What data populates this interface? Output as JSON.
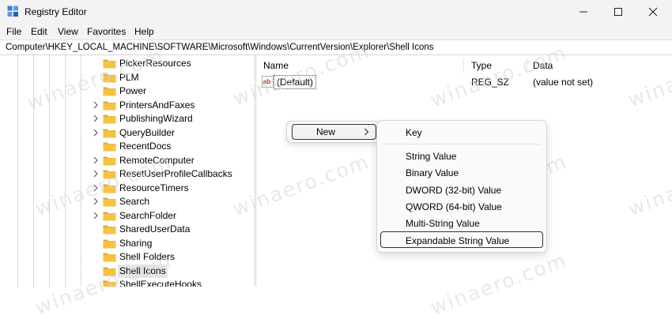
{
  "window": {
    "title": "Registry Editor"
  },
  "menu": [
    "File",
    "Edit",
    "View",
    "Favorites",
    "Help"
  ],
  "address": "Computer\\HKEY_LOCAL_MACHINE\\SOFTWARE\\Microsoft\\Windows\\CurrentVersion\\Explorer\\Shell Icons",
  "tree": [
    {
      "label": "PickerResources",
      "expandable": false,
      "selected": false
    },
    {
      "label": "PLM",
      "expandable": false,
      "selected": false
    },
    {
      "label": "Power",
      "expandable": false,
      "selected": false
    },
    {
      "label": "PrintersAndFaxes",
      "expandable": true,
      "selected": false
    },
    {
      "label": "PublishingWizard",
      "expandable": true,
      "selected": false
    },
    {
      "label": "QueryBuilder",
      "expandable": true,
      "selected": false
    },
    {
      "label": "RecentDocs",
      "expandable": false,
      "selected": false
    },
    {
      "label": "RemoteComputer",
      "expandable": true,
      "selected": false
    },
    {
      "label": "ResetUserProfileCallbacks",
      "expandable": true,
      "selected": false
    },
    {
      "label": "ResourceTimers",
      "expandable": true,
      "selected": false
    },
    {
      "label": "Search",
      "expandable": true,
      "selected": false
    },
    {
      "label": "SearchFolder",
      "expandable": true,
      "selected": false
    },
    {
      "label": "SharedUserData",
      "expandable": false,
      "selected": false
    },
    {
      "label": "Sharing",
      "expandable": false,
      "selected": false
    },
    {
      "label": "Shell Folders",
      "expandable": false,
      "selected": false
    },
    {
      "label": "Shell Icons",
      "expandable": false,
      "selected": true
    },
    {
      "label": "ShellExecuteHooks",
      "expandable": false,
      "selected": false
    }
  ],
  "list": {
    "columns": {
      "name": "Name",
      "type": "Type",
      "data": "Data"
    },
    "rows": [
      {
        "name": "(Default)",
        "type": "REG_SZ",
        "data": "(value not set)"
      }
    ]
  },
  "context_menu": {
    "new_label": "New",
    "submenu": [
      "Key",
      "String Value",
      "Binary Value",
      "DWORD (32-bit) Value",
      "QWORD (64-bit) Value",
      "Multi-String Value",
      "Expandable String Value"
    ],
    "highlighted": "Expandable String Value"
  },
  "watermark": "winaero.com",
  "colors": {
    "folder": "#f5c242",
    "folder_dark": "#e0a82e",
    "ab_icon": "#c0392b"
  }
}
